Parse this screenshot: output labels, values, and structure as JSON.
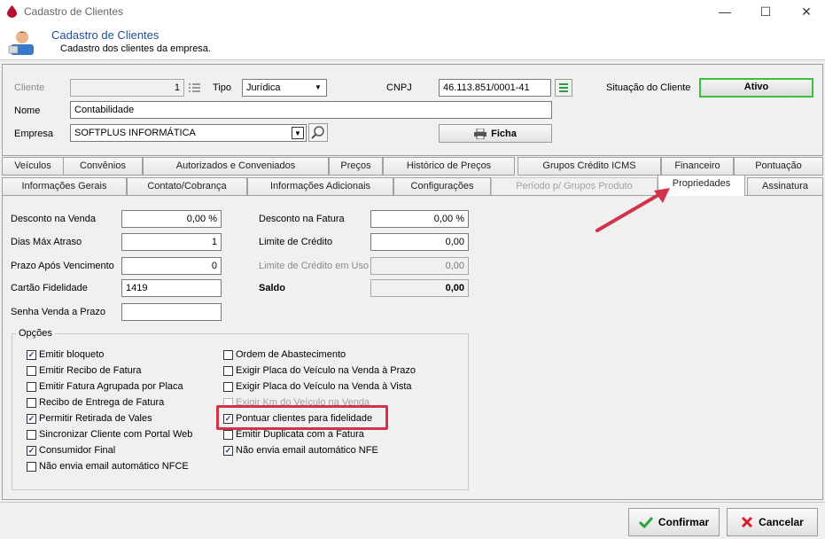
{
  "window": {
    "title": "Cadastro de Clientes",
    "minimize": "—",
    "maximize": "☐",
    "close": "✕"
  },
  "header": {
    "title": "Cadastro de Clientes",
    "subtitle": "Cadastro dos clientes da empresa."
  },
  "top": {
    "cliente_label": "Cliente",
    "cliente_value": "1",
    "tipo_label": "Tipo",
    "tipo_value": "Jurídica",
    "cnpj_label": "CNPJ",
    "cnpj_value": "46.113.851/0001-41",
    "situacao_label": "Situação do Cliente",
    "situacao_value": "Ativo",
    "nome_label": "Nome",
    "nome_value": "Contabilidade",
    "empresa_label": "Empresa",
    "empresa_value": "SOFTPLUS INFORMÁTICA",
    "ficha_label": "Ficha"
  },
  "tabs_row1": [
    "Veículos",
    "Convênios",
    "Autorizados e Conveniados",
    "Preços",
    "Histórico de Preços",
    "Grupos Crédito ICMS",
    "Financeiro",
    "Pontuação"
  ],
  "tabs_row2": [
    "Informações Gerais",
    "Contato/Cobrança",
    "Informações Adicionais",
    "Configurações",
    "Período p/ Grupos Produto",
    "Propriedades",
    "Assinatura"
  ],
  "fields_left": [
    {
      "label": "Desconto na Venda",
      "value": "0,00 %"
    },
    {
      "label": "Dias Máx Atraso",
      "value": "1"
    },
    {
      "label": "Prazo Após Vencimento",
      "value": "0"
    },
    {
      "label": "Cartão Fidelidade",
      "value": "1419"
    },
    {
      "label": "Senha Venda a Prazo",
      "value": ""
    }
  ],
  "fields_right": [
    {
      "label": "Desconto na Fatura",
      "value": "0,00 %"
    },
    {
      "label": "Limite de Crédito",
      "value": "0,00"
    },
    {
      "label": "Limite de Crédito em Uso",
      "value": "0,00"
    },
    {
      "label": "Saldo",
      "value": "0,00"
    }
  ],
  "opcoes": {
    "legend": "Opções",
    "left": [
      {
        "label": "Emitir bloqueto",
        "checked": true
      },
      {
        "label": "Emitir Recibo de Fatura",
        "checked": false
      },
      {
        "label": "Emitir Fatura Agrupada por Placa",
        "checked": false
      },
      {
        "label": "Recibo de Entrega de Fatura",
        "checked": false
      },
      {
        "label": "Permitir Retirada de Vales",
        "checked": true
      },
      {
        "label": "Sincronizar Cliente com Portal Web",
        "checked": false
      },
      {
        "label": "Consumidor Final",
        "checked": true
      },
      {
        "label": "Não envia email automático NFCE",
        "checked": false
      }
    ],
    "right": [
      {
        "label": "Ordem de Abastecimento",
        "checked": false
      },
      {
        "label": "Exigir Placa do Veículo na Venda à Prazo",
        "checked": false
      },
      {
        "label": "Exigir Placa do Veículo na Venda à Vista",
        "checked": false
      },
      {
        "label": "Exigir Km do Veículo na Venda",
        "checked": false,
        "disabled": true
      },
      {
        "label": "Pontuar clientes para fidelidade",
        "checked": true
      },
      {
        "label": "Emitir Duplicata com a Fatura",
        "checked": false
      },
      {
        "label": "Não envia email automático NFE",
        "checked": true
      }
    ]
  },
  "footer": {
    "confirmar": "Confirmar",
    "cancelar": "Cancelar"
  },
  "colors": {
    "accent_title": "#1f4f99",
    "status_border": "#3cbf3c",
    "highlight": "#d0334a"
  },
  "icons": [
    "drop-icon",
    "user-icon",
    "list-icon",
    "refresh-icon",
    "search-icon",
    "printer-icon",
    "check-icon",
    "x-icon"
  ]
}
